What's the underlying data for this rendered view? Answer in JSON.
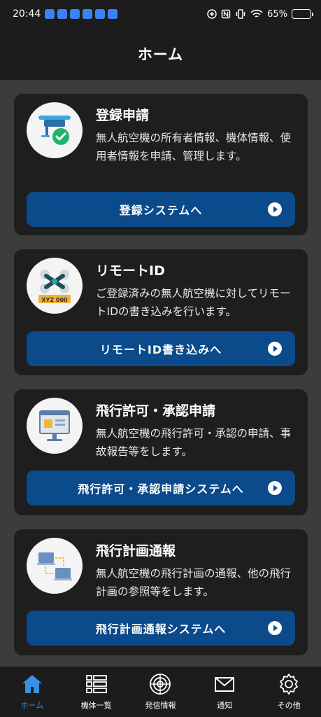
{
  "status_bar": {
    "time": "20:44",
    "battery_text": "65%",
    "battery_level": 0.65
  },
  "app_bar": {
    "title": "ホーム"
  },
  "cards": [
    {
      "title": "登録申請",
      "description": "無人航空機の所有者情報、機体情報、使用者情報を申請、管理します。",
      "button_label": "登録システムへ",
      "icon": "drone-registration-icon"
    },
    {
      "title": "リモートID",
      "description": "ご登録済みの無人航空機に対してリモートIDの書き込みを行います。",
      "button_label": "リモートID書き込みへ",
      "icon": "remote-id-icon",
      "icon_tag": "XYZ 000"
    },
    {
      "title": "飛行許可・承認申請",
      "description": "無人航空機の飛行許可・承認の申請、事故報告等をします。",
      "button_label": "飛行許可・承認申請システムへ",
      "icon": "flight-permit-icon"
    },
    {
      "title": "飛行計画通報",
      "description": "無人航空機の飛行計画の通報、他の飛行計画の参照等をします。",
      "button_label": "飛行計画通報システムへ",
      "icon": "flight-plan-icon"
    }
  ],
  "bottom_nav": [
    {
      "label": "ホーム",
      "icon": "home-icon",
      "active": true
    },
    {
      "label": "機体一覧",
      "icon": "list-icon",
      "active": false
    },
    {
      "label": "発信情報",
      "icon": "radar-icon",
      "active": false
    },
    {
      "label": "通知",
      "icon": "mail-icon",
      "active": false
    },
    {
      "label": "その他",
      "icon": "gear-icon",
      "active": false
    }
  ],
  "colors": {
    "background": "#3c3c3c",
    "card": "#1e1e1e",
    "button": "#0b4a8b",
    "accent": "#3b8fe6"
  }
}
